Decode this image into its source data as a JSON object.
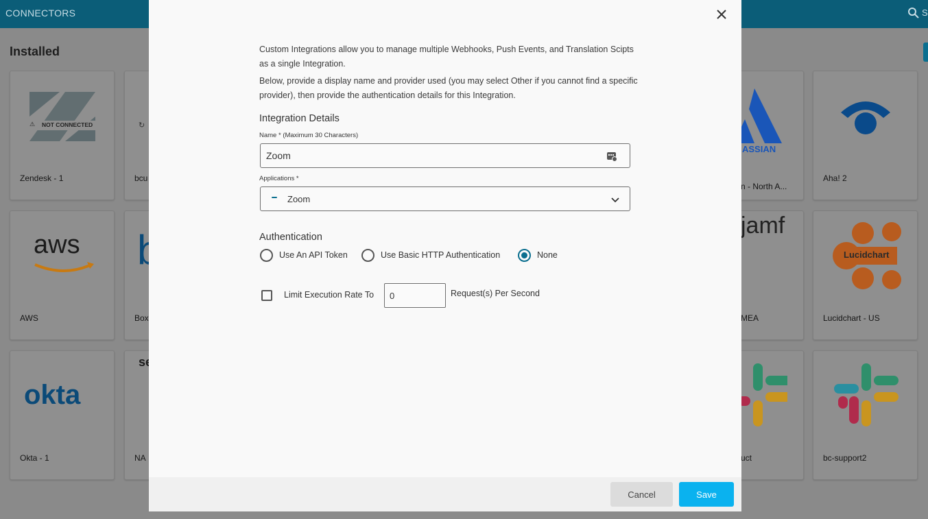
{
  "app": {
    "title": "CONNECTORS",
    "search_partial": "S",
    "section_title": "Installed"
  },
  "connectors": [
    {
      "label": "Zendesk - 1",
      "logo": "zendesk-logo",
      "status": "NOT CONNECTED"
    },
    {
      "label": "bcu",
      "logo": "unknown-logo"
    },
    {
      "label": "n - North A...",
      "logo": "atlassian-logo",
      "logo_text": "ASSIAN"
    },
    {
      "label": "Aha! 2",
      "logo": "aha-logo"
    },
    {
      "label": "AWS",
      "logo": "aws-logo",
      "logo_text": "aws"
    },
    {
      "label": "Box",
      "logo": "box-logo"
    },
    {
      "label": "MEA",
      "logo": "jamf-logo",
      "logo_text": "jamf"
    },
    {
      "label": "Lucidchart - US",
      "logo": "lucidchart-logo",
      "logo_text": "Lucidchart"
    },
    {
      "label": "Okta - 1",
      "logo": "okta-logo",
      "logo_text": "okta"
    },
    {
      "label": "NA",
      "logo": "se-logo",
      "logo_text": "se"
    },
    {
      "label": "uct",
      "logo": "slack-logo"
    },
    {
      "label": "bc-support2",
      "logo": "slack-logo"
    }
  ],
  "modal": {
    "intro_1": "Custom Integrations allow you to manage multiple Webhooks, Push Events, and Translation Scipts as a single Integration.",
    "intro_2": "Below, provide a display name and provider used (you may select Other if you cannot find a specific provider), then provide the authentication details for this Integration.",
    "details_title": "Integration Details",
    "name_label": "Name * (Maximum 30 Characters)",
    "name_value": "Zoom",
    "applications_label": "Applications *",
    "application_value": "Zoom",
    "auth_title": "Authentication",
    "auth_options": [
      "Use An API Token",
      "Use Basic HTTP Authentication",
      "None"
    ],
    "auth_selected": "None",
    "limit_label": "Limit Execution Rate To",
    "limit_checked": false,
    "limit_value": "0",
    "limit_suffix": "Request(s) Per Second",
    "cancel_label": "Cancel",
    "save_label": "Save"
  },
  "colors": {
    "accent": "#0b6f8f",
    "save": "#0ab2ef",
    "topbar": "#0b5d78"
  }
}
